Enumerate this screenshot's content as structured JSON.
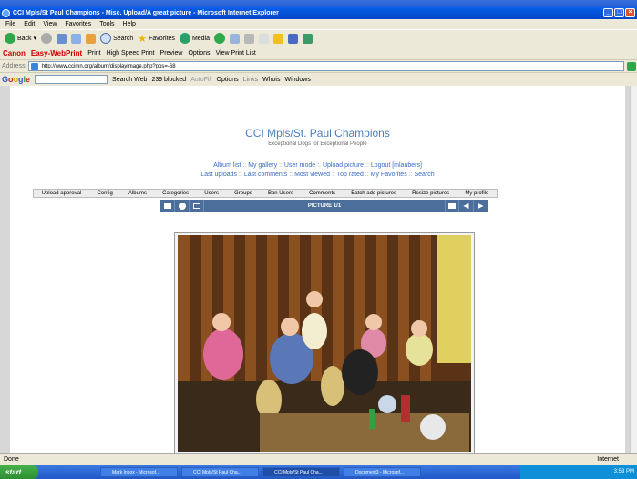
{
  "window": {
    "title": "CCI Mpls/St Paul Champions - Misc. Upload/A great picture - Microsoft Internet Explorer"
  },
  "menu": [
    "File",
    "Edit",
    "View",
    "Favorites",
    "Tools",
    "Help"
  ],
  "toolbar": {
    "back": "Back",
    "search": "Search",
    "favorites": "Favorites",
    "media": "Media"
  },
  "canon": {
    "brand": "Canon",
    "app": "Easy-WebPrint",
    "print": "Print",
    "hsprint": "High Speed Print",
    "preview": "Preview",
    "options": "Options",
    "viewlist": "View Print List"
  },
  "address": {
    "label": "Address",
    "url": "http://www.ccimn.org/album/displayimage.php?pos=-68",
    "go": "Go"
  },
  "google": {
    "search_web": "Search Web",
    "blocked": "239 blocked",
    "autofill": "AutoFill",
    "options": "Options",
    "links": "Links",
    "whois": "Whois",
    "windows": "Windows"
  },
  "site": {
    "title": "CCI Mpls/St. Paul Champions",
    "tagline": "Exceptional Dogs for Exceptional People"
  },
  "nav": {
    "row1": [
      "Album list",
      "My gallery",
      "User mode",
      "Upload picture",
      "Logout [mlaubers]"
    ],
    "row2": [
      "Last uploads",
      "Last comments",
      "Most viewed",
      "Top rated",
      "My Favorites",
      "Search"
    ]
  },
  "admin_tabs": [
    "Upload approval",
    "Config",
    "Albums",
    "Categories",
    "Users",
    "Groups",
    "Ban Users",
    "Comments",
    "Batch add pictures",
    "Resize pictures",
    "My profile"
  ],
  "picture_bar": {
    "title": "PICTURE 1/1"
  },
  "status": {
    "left": "Done",
    "right": "Internet"
  },
  "taskbar": {
    "start": "start",
    "items": [
      "Mark Inbox - Microsof...",
      "CCI Mpls/St Paul Cha...",
      "CCI Mpls/St Paul Cha...",
      "Document3 - Microsof..."
    ],
    "clock": "3:53 PM"
  }
}
